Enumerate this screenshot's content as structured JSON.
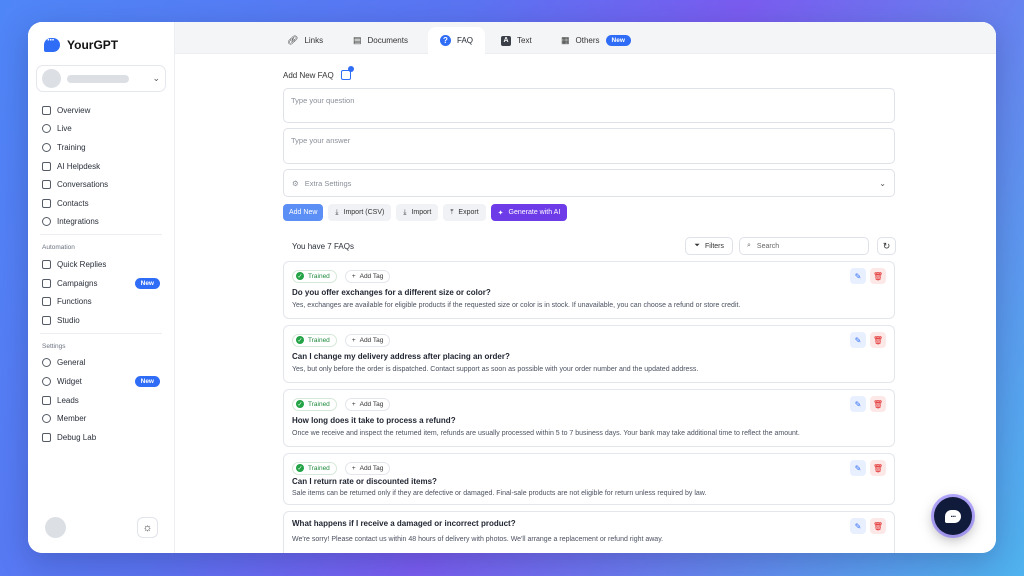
{
  "brand": {
    "name": "YourGPT"
  },
  "sidebar": {
    "items": [
      {
        "label": "Overview",
        "icon": "grid-icon"
      },
      {
        "label": "Live",
        "icon": "radio-icon"
      },
      {
        "label": "Training",
        "icon": "brain-icon"
      },
      {
        "label": "AI Helpdesk",
        "icon": "monitor-icon"
      },
      {
        "label": "Conversations",
        "icon": "chat-icon"
      },
      {
        "label": "Contacts",
        "icon": "contacts-icon"
      },
      {
        "label": "Integrations",
        "icon": "plug-icon"
      }
    ],
    "automation_title": "Automation",
    "automation_items": [
      {
        "label": "Quick Replies",
        "icon": "reply-icon"
      },
      {
        "label": "Campaigns",
        "icon": "megaphone-icon",
        "badge": "New"
      },
      {
        "label": "Functions",
        "icon": "function-icon"
      },
      {
        "label": "Studio",
        "icon": "studio-icon"
      }
    ],
    "settings_title": "Settings",
    "settings_items": [
      {
        "label": "General",
        "icon": "gear-icon"
      },
      {
        "label": "Widget",
        "icon": "widget-icon",
        "badge": "New"
      },
      {
        "label": "Leads",
        "icon": "funnel-icon"
      },
      {
        "label": "Member",
        "icon": "users-icon"
      },
      {
        "label": "Debug Lab",
        "icon": "flask-icon"
      }
    ]
  },
  "tabs": [
    {
      "label": "Links",
      "icon": "link-icon"
    },
    {
      "label": "Documents",
      "icon": "document-icon"
    },
    {
      "label": "FAQ",
      "icon": "question-icon"
    },
    {
      "label": "Text",
      "icon": "text-icon"
    },
    {
      "label": "Others",
      "icon": "apps-icon",
      "badge": "New"
    }
  ],
  "form": {
    "title": "Add New FAQ",
    "question_placeholder": "Type your question",
    "answer_placeholder": "Type your answer",
    "extra_settings": "Extra Settings"
  },
  "actions": {
    "add_new": "Add New",
    "import_csv": "Import (CSV)",
    "import": "Import",
    "export": "Export",
    "generate_ai": "Generate with AI"
  },
  "list": {
    "count_text": "You have 7 FAQs",
    "filters": "Filters",
    "search_placeholder": "Search",
    "trained_label": "Trained",
    "add_tag_label": "Add Tag"
  },
  "faqs": [
    {
      "question": "Do you offer exchanges for a different size or color?",
      "answer": "Yes, exchanges are available for eligible products if the requested size or color is in stock. If unavailable, you can choose a refund or store credit."
    },
    {
      "question": "Can I change my delivery address after placing an order?",
      "answer": "Yes, but only before the order is dispatched. Contact support as soon as possible with your order number and the updated address."
    },
    {
      "question": "How long does it take to process a refund?",
      "answer": "Once we receive and inspect the returned item, refunds are usually processed within 5 to 7 business days. Your bank may take additional time to reflect the amount."
    },
    {
      "question": "Can I return rate or discounted items?",
      "answer": "Sale items can be returned only if they are defective or damaged. Final-sale products are not eligible for return unless required by law."
    },
    {
      "question": "What happens if I receive a damaged or incorrect product?",
      "answer": "We're sorry! Please contact us within 48 hours of delivery with photos. We'll arrange a replacement or refund right away."
    }
  ],
  "colors": {
    "accent": "#2f6df6",
    "ai_button": "#6d3be8",
    "trained": "#22a447",
    "delete": "#e02424"
  }
}
